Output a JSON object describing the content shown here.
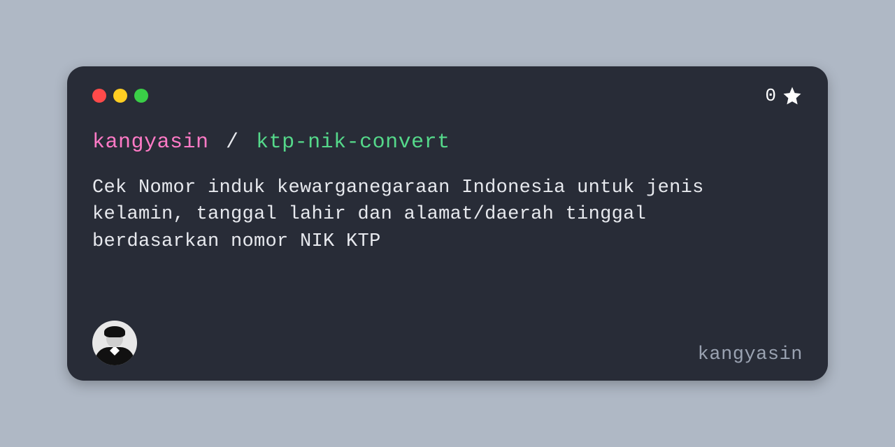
{
  "window": {
    "stars_count": "0"
  },
  "repo": {
    "owner": "kangyasin",
    "separator": "/",
    "name": "ktp-nik-convert",
    "description": "Cek Nomor induk kewarganegaraan Indonesia untuk jenis kelamin, tanggal lahir dan alamat/daerah tinggal berdasarkan nomor NIK KTP"
  },
  "footer": {
    "username": "kangyasin"
  }
}
